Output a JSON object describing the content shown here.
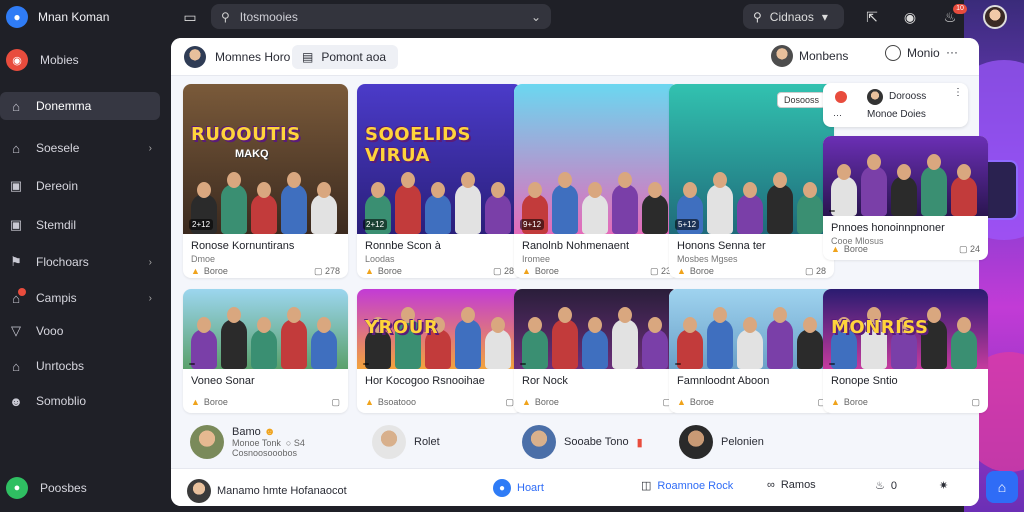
{
  "app": {
    "name": "Mnan Koman"
  },
  "sidebar": {
    "items": [
      {
        "label": "Mobies",
        "icon": "red-circle-icon"
      },
      {
        "label": "Donemma",
        "icon": "home-icon"
      },
      {
        "label": "Soesele",
        "icon": "home-outline-icon"
      },
      {
        "label": "Dereoin",
        "icon": "image-icon"
      },
      {
        "label": "Stemdil",
        "icon": "image-icon"
      },
      {
        "label": "Flochoars",
        "icon": "flag-icon"
      },
      {
        "label": "Campis",
        "icon": "house-icon"
      },
      {
        "label": "Vooo",
        "icon": "pin-icon"
      },
      {
        "label": "Unrtocbs",
        "icon": "home-outline-icon"
      },
      {
        "label": "Somoblio",
        "icon": "users-icon"
      }
    ],
    "footer": {
      "label": "Poosbes"
    }
  },
  "topbar": {
    "search_placeholder": "Itosmooies",
    "filter_label": "Cidnaos",
    "notification_count": "10"
  },
  "panel": {
    "header": {
      "title": "Momnes Horo",
      "chip": "Pomont aoa",
      "right_user": "Monbens",
      "right_action": "Monio",
      "more": "···"
    },
    "mini_card": {
      "line1": "Dorooss",
      "line2": "Monoe Doies"
    },
    "cards": [
      {
        "title": "Ronose Kornuntirans",
        "sub": "Dmoe",
        "author": "Boroe",
        "count": "278",
        "overlay": "RUOOUTIS",
        "overlay_sub": "MAKQ",
        "tag": "2+12"
      },
      {
        "title": "Ronnbe Scon à",
        "sub": "Loodas",
        "author": "Boroe",
        "count": "28",
        "overlay": "SOOELIDS VIRUA",
        "overlay_sub": "",
        "tag": "2+12"
      },
      {
        "title": "Ranolnb Nohmenaent",
        "sub": "Iromee",
        "author": "Boroe",
        "count": "23",
        "overlay": "",
        "overlay_sub": "",
        "tag": "9+12"
      },
      {
        "title": "Honons Senna ter",
        "sub": "Mosbes Mgses",
        "author": "Boroe",
        "count": "28",
        "overlay": "",
        "overlay_sub": "",
        "tag": "5+12",
        "badge": "Dosooss"
      },
      {
        "title": "Pnnoes honoinnpnoner",
        "sub": "Cooe Mlosus",
        "author": "Boroe",
        "count": "24",
        "overlay": "",
        "overlay_sub": "",
        "tag": ""
      },
      {
        "title": "Voneo Sonar",
        "sub": "",
        "author": "Boroe",
        "count": "",
        "overlay": "",
        "overlay_sub": "",
        "tag": ""
      },
      {
        "title": "Hor Kocogoo Rsnooihae",
        "sub": "",
        "author": "Bsoatooo",
        "count": "",
        "overlay": "YROUR",
        "overlay_sub": "",
        "tag": ""
      },
      {
        "title": "Ror Nock",
        "sub": "",
        "author": "Boroe",
        "count": "",
        "overlay": "",
        "overlay_sub": "",
        "tag": ""
      },
      {
        "title": "Famnloodnt Aboon",
        "sub": "",
        "author": "Boroe",
        "count": "",
        "overlay": "",
        "overlay_sub": "",
        "tag": ""
      },
      {
        "title": "Ronope Sntio",
        "sub": "",
        "author": "Boroe",
        "count": "",
        "overlay": "MONRISS",
        "overlay_sub": "",
        "tag": ""
      }
    ],
    "profiles": [
      {
        "name": "Bamo",
        "sub1": "Monoe Tonk",
        "sub2": "Cosnoosooobos",
        "stat": "S4"
      },
      {
        "name": "Rolet"
      },
      {
        "name": "Sooabe Tono"
      },
      {
        "name": "Pelonien"
      }
    ],
    "bottom": {
      "comment": "Manamo hmte Hofanaocot",
      "home": "Hoart",
      "share": "Roamnoe Rock",
      "react": "Ramos",
      "count": "0"
    }
  },
  "colors": {
    "accent": "#2f7cf6",
    "sidebar_bg": "#1f2027",
    "panel_bg": "#f4f6fb",
    "danger": "#e84c3d"
  }
}
